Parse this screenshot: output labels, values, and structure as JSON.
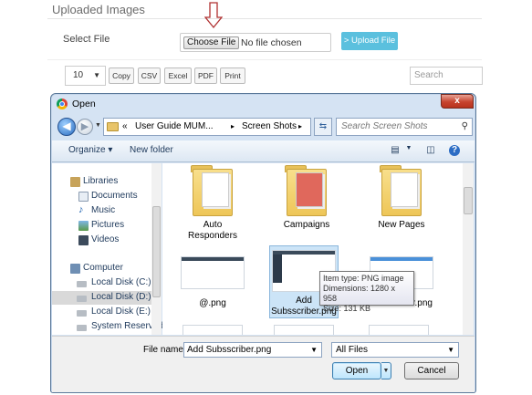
{
  "page": {
    "section_title": "Uploaded Images",
    "select_file_label": "Select File",
    "choose_file_label": "Choose File",
    "no_file_text": "No file chosen",
    "upload_button": "> Upload File",
    "page_length": "10",
    "export_buttons": [
      "Copy",
      "CSV",
      "Excel",
      "PDF",
      "Print"
    ],
    "search_placeholder": "Search"
  },
  "dialog": {
    "title": "Open",
    "close_label": "x",
    "breadcrumb": [
      "«",
      "User Guide MUM...",
      "▸",
      "Screen Shots",
      "▸"
    ],
    "search_placeholder": "Search Screen Shots",
    "toolbar": {
      "organize": "Organize ▾",
      "new_folder": "New folder"
    },
    "nav": {
      "items": [
        {
          "label": "Libraries",
          "icon": "libraries-icon",
          "level": 0
        },
        {
          "label": "Documents",
          "icon": "documents-icon",
          "level": 1
        },
        {
          "label": "Music",
          "icon": "music-icon",
          "level": 1
        },
        {
          "label": "Pictures",
          "icon": "pictures-icon",
          "level": 1
        },
        {
          "label": "Videos",
          "icon": "videos-icon",
          "level": 1
        },
        {
          "label": "Computer",
          "icon": "computer-icon",
          "level": 0
        },
        {
          "label": "Local Disk (C:)",
          "icon": "drive-icon",
          "level": 1
        },
        {
          "label": "Local Disk (D:)",
          "icon": "drive-icon",
          "level": 1,
          "selected": true
        },
        {
          "label": "Local Disk (E:)",
          "icon": "drive-icon",
          "level": 1
        },
        {
          "label": "System Reserved",
          "icon": "drive-icon",
          "level": 1
        }
      ]
    },
    "files": [
      {
        "label": "Auto Responders",
        "kind": "folder"
      },
      {
        "label": "Campaigns",
        "kind": "folder-red"
      },
      {
        "label": "New Pages",
        "kind": "folder"
      },
      {
        "label": "@.png",
        "kind": "image"
      },
      {
        "label": "Add Subsscriber.png",
        "kind": "image",
        "selected": true
      },
      {
        "label": "r.png",
        "kind": "image"
      }
    ],
    "tooltip": {
      "type": "Item type: PNG image",
      "dimensions": "Dimensions: 1280 x 958",
      "size": "Size: 131 KB"
    },
    "file_name_label": "File name:",
    "file_name_value": "Add Subsscriber.png",
    "file_type_value": "All Files",
    "open_button": "Open",
    "cancel_button": "Cancel"
  },
  "colors": {
    "upload_button": "#5bc0de",
    "dialog_frame": "#d5e3f3",
    "selection": "#cce4f7"
  }
}
